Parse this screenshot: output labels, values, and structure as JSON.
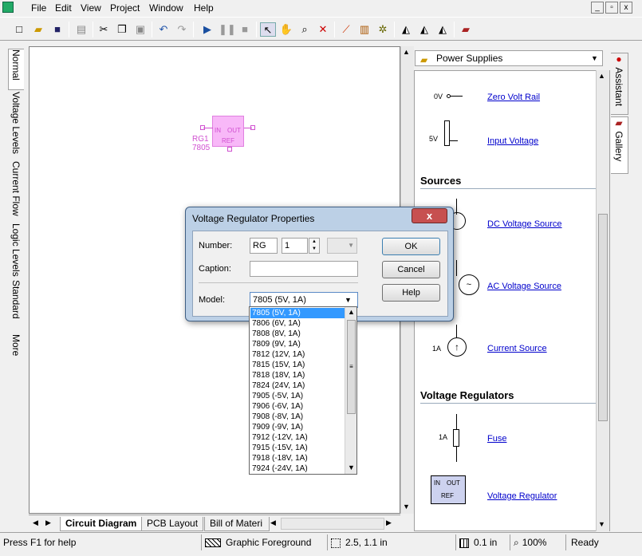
{
  "menubar": {
    "items": [
      "File",
      "Edit",
      "View",
      "Project",
      "Window",
      "Help"
    ],
    "window_controls": [
      "_",
      "▫",
      "x"
    ]
  },
  "toolbar": {
    "icons": [
      "new-icon",
      "open-icon",
      "save-icon",
      "print-icon",
      "cut-icon",
      "copy-icon",
      "paste-icon",
      "undo-icon",
      "redo-icon",
      "play-icon",
      "pause-icon",
      "stop-icon",
      "pointer-icon",
      "hand-icon",
      "zoom-icon",
      "delete-icon",
      "probe-icon",
      "components-icon",
      "logic-icon",
      "ruler-icon",
      "bom-icon",
      "gallery-icon",
      "book-icon"
    ]
  },
  "left_tabs": [
    "Normal",
    "Voltage Levels",
    "Current Flow",
    "Logic Levels",
    "Standard",
    "More"
  ],
  "canvas": {
    "component": {
      "designator": "RG1",
      "part": "7805",
      "pin_in": "IN",
      "pin_out": "OUT",
      "pin_ref": "REF",
      "color": "#f8b8f8"
    }
  },
  "bottom_tabs": [
    "Circuit Diagram",
    "PCB Layout",
    "Bill of Materi"
  ],
  "gallery": {
    "category": "Power Supplies",
    "items": {
      "zero_volt_rail": {
        "symbol": "0V",
        "label": "Zero Volt Rail"
      },
      "input_voltage": {
        "symbol": "5V",
        "label": "Input Voltage"
      },
      "sources_heading": "Sources",
      "dc_source": {
        "label": "DC Voltage Source"
      },
      "ac_source": {
        "label": "AC Voltage Source"
      },
      "current_source": {
        "symbol": "1A",
        "label": "Current Source"
      },
      "regulators_heading": "Voltage Regulators",
      "fuse": {
        "symbol": "1A",
        "label": "Fuse"
      },
      "voltage_regulator": {
        "label": "Voltage Regulator",
        "pin_in": "IN",
        "pin_out": "OUT",
        "pin_ref": "REF"
      }
    }
  },
  "right_tabs": [
    "Assistant",
    "Gallery"
  ],
  "statusbar": {
    "help": "Press F1 for help",
    "layer": "Graphic Foreground",
    "coords": "2.5, 1.1 in",
    "grid": "0.1 in",
    "zoom": "100%",
    "state": "Ready"
  },
  "dialog": {
    "title": "Voltage Regulator Properties",
    "number_label": "Number:",
    "number_prefix": "RG",
    "number_value": "1",
    "caption_label": "Caption:",
    "caption_value": "",
    "model_label": "Model:",
    "model_value": "7805 (5V, 1A)",
    "ok": "OK",
    "cancel": "Cancel",
    "help": "Help",
    "close": "x"
  },
  "model_options": [
    "7805 (5V, 1A)",
    "7806 (6V, 1A)",
    "7808 (8V, 1A)",
    "7809 (9V, 1A)",
    "7812 (12V, 1A)",
    "7815 (15V, 1A)",
    "7818 (18V, 1A)",
    "7824 (24V, 1A)",
    "7905 (-5V, 1A)",
    "7906 (-6V, 1A)",
    "7908 (-8V, 1A)",
    "7909 (-9V, 1A)",
    "7912 (-12V, 1A)",
    "7915 (-15V, 1A)",
    "7918 (-18V, 1A)",
    "7924 (-24V, 1A)"
  ],
  "colors": {
    "link": "#0000cc",
    "selection": "#3399ff",
    "component_pink": "#f8b8f8",
    "dialog_frame": "#bcd0e6",
    "close_red": "#c75050"
  }
}
